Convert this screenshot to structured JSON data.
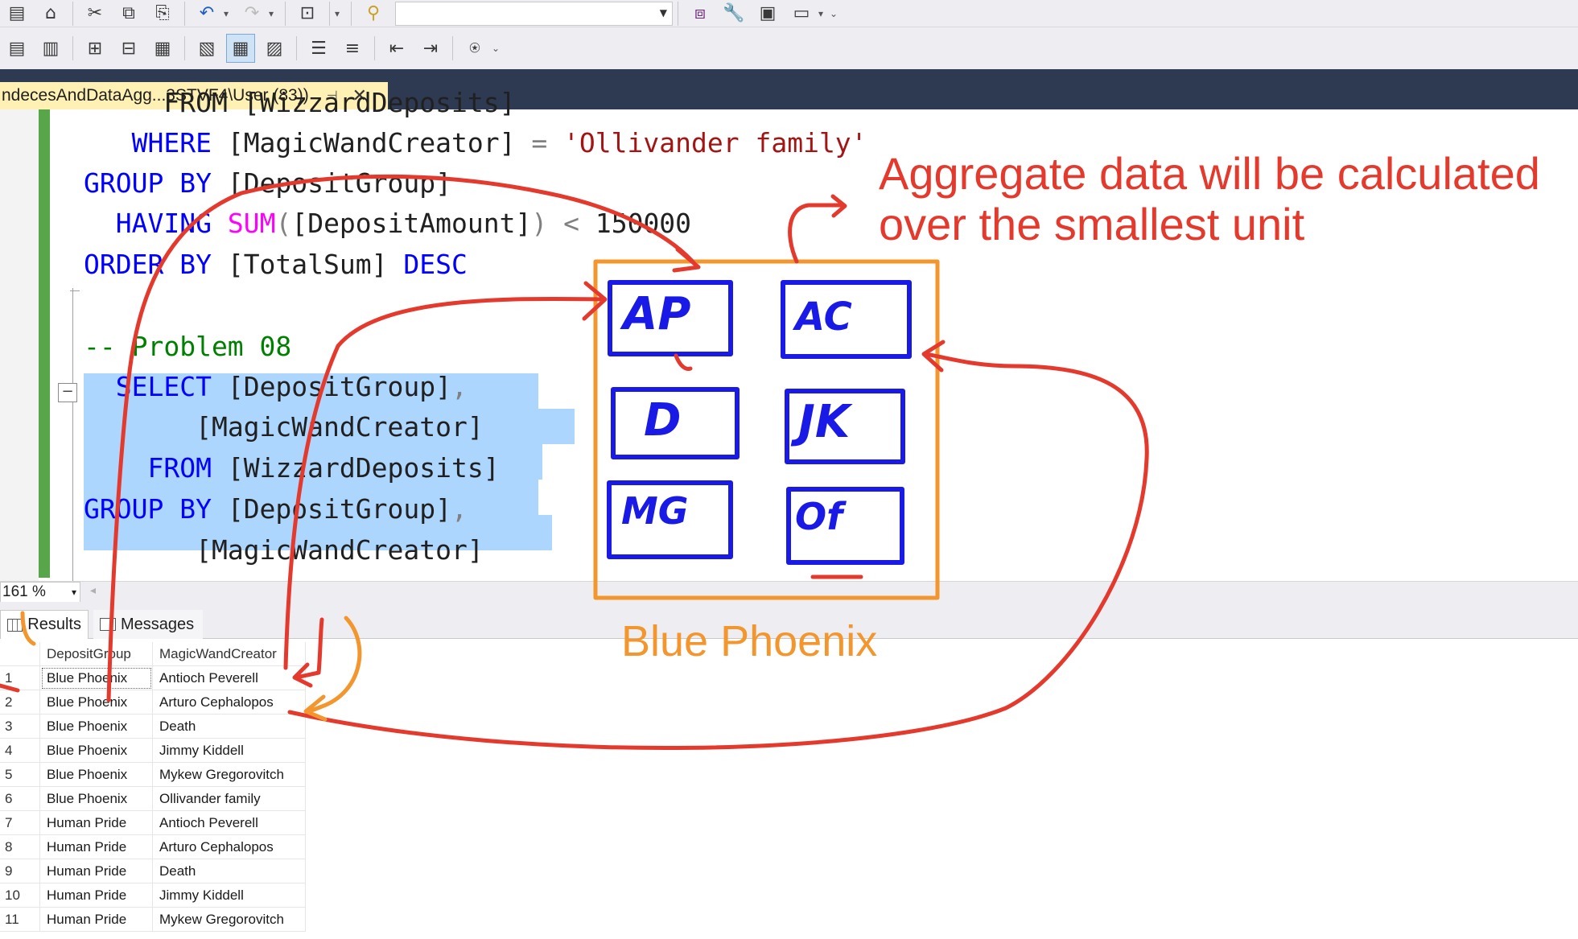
{
  "toolbar_top": {
    "combo_value": "",
    "icons": [
      "new-query-icon",
      "cut-icon",
      "copy-icon",
      "paste-icon",
      "undo-icon",
      "redo-icon",
      "solution-explorer-icon",
      "find-icon",
      "vs-icon",
      "wrench-icon",
      "toolbox-icon",
      "console-icon"
    ]
  },
  "toolbar_second": {
    "icons": [
      "results-to-text-icon",
      "results-to-file-icon",
      "estimated-plan-icon",
      "actual-plan-icon",
      "client-statistics-icon",
      "query-options-icon",
      "results-to-grid-icon",
      "include-plan-icon",
      "comment-icon",
      "uncomment-icon",
      "outdent-icon",
      "indent-icon",
      "specify-values-icon"
    ]
  },
  "document_tab": {
    "title": "ndecesAndDataAgg...3STVF4\\User (83))",
    "pin_glyph": "⊣",
    "close_glyph": "✕"
  },
  "editor": {
    "line_partial": " FROM [WizzardDeposits]",
    "where_kw": "WHERE",
    "where_col": " [MagicWandCreator] ",
    "where_op": "=",
    "where_val": " 'Ollivander family'",
    "group_kw": "GROUP BY",
    "group_col": " [DepositGroup]",
    "having_kw": "HAVING",
    "having_fn": " SUM",
    "having_paren_open": "(",
    "having_col": "[DepositAmount]",
    "having_paren_close": ")",
    "having_op": " <",
    "having_val": " 150000",
    "order_kw": "ORDER BY",
    "order_col": " [TotalSum]",
    "order_dir": " DESC",
    "comment": "-- Problem 08",
    "select_kw": "SELECT",
    "select_col1": " [DepositGroup]",
    "comma": ",",
    "select_col2": "[MagicWandCreator]",
    "from_kw": "FROM",
    "from_table": " [WizzardDeposits]",
    "group2_kw": "GROUP BY",
    "group2_col1": " [DepositGroup]",
    "group2_col2": "[MagicWandCreator]",
    "collapse_glyph": "−"
  },
  "zoom": {
    "level": "161 %",
    "arrow": "▾",
    "scroll_arrow": "◂"
  },
  "result_tabs": {
    "results": "Results",
    "messages": "Messages"
  },
  "grid": {
    "columns": [
      "DepositGroup",
      "MagicWandCreator"
    ],
    "rows": [
      {
        "n": "1",
        "group": "Blue Phoenix",
        "creator": "Antioch Peverell"
      },
      {
        "n": "2",
        "group": "Blue Phoenix",
        "creator": "Arturo Cephalopos"
      },
      {
        "n": "3",
        "group": "Blue Phoenix",
        "creator": "Death"
      },
      {
        "n": "4",
        "group": "Blue Phoenix",
        "creator": "Jimmy Kiddell"
      },
      {
        "n": "5",
        "group": "Blue Phoenix",
        "creator": "Mykew Gregorovitch"
      },
      {
        "n": "6",
        "group": "Blue Phoenix",
        "creator": "Ollivander family"
      },
      {
        "n": "7",
        "group": "Human Pride",
        "creator": "Antioch Peverell"
      },
      {
        "n": "8",
        "group": "Human Pride",
        "creator": "Arturo Cephalopos"
      },
      {
        "n": "9",
        "group": "Human Pride",
        "creator": "Death"
      },
      {
        "n": "10",
        "group": "Human Pride",
        "creator": "Jimmy Kiddell"
      },
      {
        "n": "11",
        "group": "Human Pride",
        "creator": "Mykew Gregorovitch"
      }
    ]
  },
  "annotation": {
    "note_line1": "Aggregate data will be calculated",
    "note_line2": "over the smallest unit",
    "group_label": "Blue Phoenix",
    "boxes": [
      "AP",
      "AC",
      "D",
      "JK",
      "MG",
      "Of"
    ],
    "colors": {
      "red": "#e43a2e",
      "orange": "#f2962d",
      "blue": "#1a1ae6"
    }
  },
  "colors": {
    "keyword": "#0000ff",
    "string": "#a31515",
    "function": "#ff00ff",
    "comment": "#008000",
    "selection": "#add6ff",
    "tab_active": "#fff0b3",
    "tabstrip": "#2d3a52"
  }
}
